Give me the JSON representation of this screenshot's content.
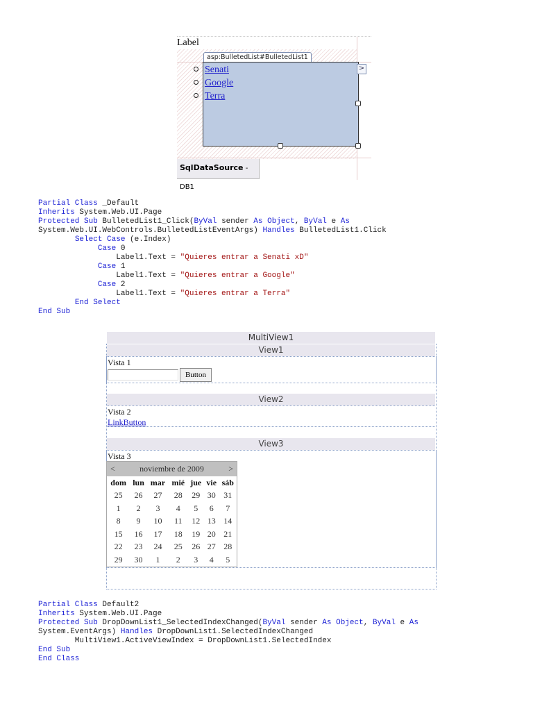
{
  "designer": {
    "label": "Label",
    "tag": "asp:BulletedList#BulletedList1",
    "items": [
      "Senati",
      "Google",
      "Terra"
    ],
    "smart_tag": ">",
    "datasource_name": "SqlDataSource",
    "datasource_id": " - DB1"
  },
  "code1": [
    [
      [
        "Partial Class",
        "kw"
      ],
      [
        " _Default",
        ""
      ]
    ],
    [
      [
        "Inherits",
        "kw"
      ],
      [
        " System.Web.UI.Page",
        ""
      ]
    ],
    [
      [
        "Protected Sub",
        "kw"
      ],
      [
        " BulletedList1_Click(",
        ""
      ],
      [
        "ByVal",
        "kw"
      ],
      [
        " sender ",
        ""
      ],
      [
        "As",
        "kw"
      ],
      [
        " ",
        ""
      ],
      [
        "Object",
        "kw"
      ],
      [
        ", ",
        ""
      ],
      [
        "ByVal",
        "kw"
      ],
      [
        " e ",
        ""
      ],
      [
        "As",
        "kw"
      ]
    ],
    [
      [
        "System.Web.UI.WebControls.BulletedListEventArgs) ",
        ""
      ],
      [
        "Handles",
        "kw"
      ],
      [
        " BulletedList1.Click",
        ""
      ]
    ],
    [
      [
        "        ",
        ""
      ],
      [
        "Select Case",
        "kw"
      ],
      [
        " (e.Index)",
        ""
      ]
    ],
    [
      [
        "             ",
        ""
      ],
      [
        "Case",
        "kw"
      ],
      [
        " 0",
        ""
      ]
    ],
    [
      [
        "                 Label1.Text = ",
        ""
      ],
      [
        "\"Quieres entrar a Senati xD\"",
        "str"
      ]
    ],
    [
      [
        "             ",
        ""
      ],
      [
        "Case",
        "kw"
      ],
      [
        " 1",
        ""
      ]
    ],
    [
      [
        "                 Label1.Text = ",
        ""
      ],
      [
        "\"Quieres entrar a Google\"",
        "str"
      ]
    ],
    [
      [
        "             ",
        ""
      ],
      [
        "Case",
        "kw"
      ],
      [
        " 2",
        ""
      ]
    ],
    [
      [
        "                 Label1.Text = ",
        ""
      ],
      [
        "\"Quieres entrar a Terra\"",
        "str"
      ]
    ],
    [
      [
        "        ",
        ""
      ],
      [
        "End Select",
        "kw"
      ]
    ],
    [
      [
        "End Sub",
        "kw"
      ]
    ]
  ],
  "multiview": {
    "title": "MultiView1",
    "views": [
      {
        "header": "View1",
        "label": "Vista 1",
        "textbox_value": "",
        "button": "Button"
      },
      {
        "header": "View2",
        "label": "Vista 2",
        "link": "LinkButton"
      },
      {
        "header": "View3",
        "label": "Vista 3"
      }
    ]
  },
  "calendar": {
    "prev": "<",
    "next": ">",
    "month": "noviembre de 2009",
    "days": [
      "dom",
      "lun",
      "mar",
      "mié",
      "jue",
      "vie",
      "sáb"
    ],
    "weeks": [
      [
        "25",
        "26",
        "27",
        "28",
        "29",
        "30",
        "31"
      ],
      [
        "1",
        "2",
        "3",
        "4",
        "5",
        "6",
        "7"
      ],
      [
        "8",
        "9",
        "10",
        "11",
        "12",
        "13",
        "14"
      ],
      [
        "15",
        "16",
        "17",
        "18",
        "19",
        "20",
        "21"
      ],
      [
        "22",
        "23",
        "24",
        "25",
        "26",
        "27",
        "28"
      ],
      [
        "29",
        "30",
        "1",
        "2",
        "3",
        "4",
        "5"
      ]
    ]
  },
  "code2": [
    [
      [
        "Partial Class",
        "kw"
      ],
      [
        " Default2",
        ""
      ]
    ],
    [
      [
        "Inherits",
        "kw"
      ],
      [
        " System.Web.UI.Page",
        ""
      ]
    ],
    [
      [
        "Protected Sub",
        "kw"
      ],
      [
        " DropDownList1_SelectedIndexChanged(",
        ""
      ],
      [
        "ByVal",
        "kw"
      ],
      [
        " sender ",
        ""
      ],
      [
        "As",
        "kw"
      ],
      [
        " ",
        ""
      ],
      [
        "Object",
        "kw"
      ],
      [
        ", ",
        ""
      ],
      [
        "ByVal",
        "kw"
      ],
      [
        " e ",
        ""
      ],
      [
        "As",
        "kw"
      ]
    ],
    [
      [
        "System.EventArgs) ",
        ""
      ],
      [
        "Handles",
        "kw"
      ],
      [
        " DropDownList1.SelectedIndexChanged",
        ""
      ]
    ],
    [
      [
        "        MultiView1.ActiveViewIndex = DropDownList1.SelectedIndex",
        ""
      ]
    ],
    [
      [
        "End Sub",
        "kw"
      ]
    ],
    [
      [
        "End Class",
        "kw"
      ]
    ]
  ]
}
